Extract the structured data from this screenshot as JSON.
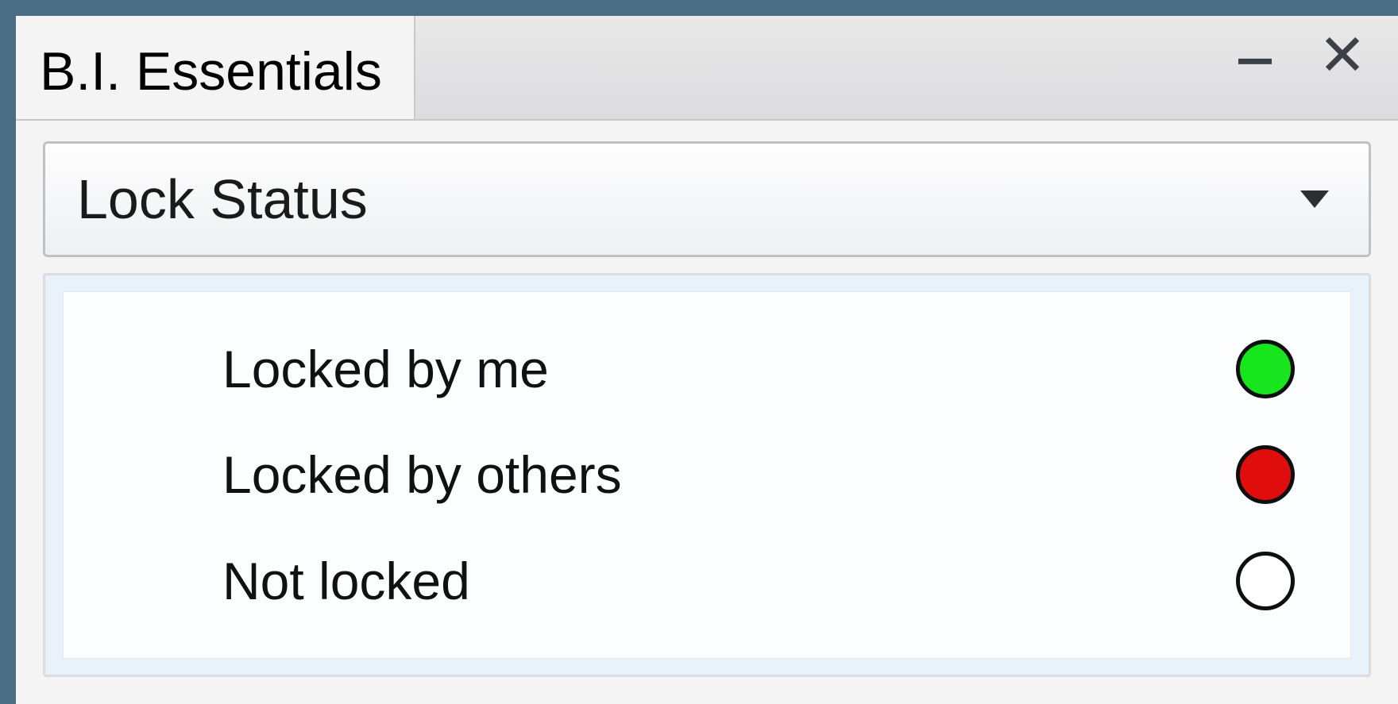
{
  "titlebar": {
    "title": "B.I. Essentials"
  },
  "dropdown": {
    "label": "Lock Status"
  },
  "legend": {
    "items": [
      {
        "label": "Locked by me",
        "color": "#17e61e"
      },
      {
        "label": "Locked by others",
        "color": "#e00d0d"
      },
      {
        "label": "Not locked",
        "color": "#ffffff"
      }
    ]
  }
}
